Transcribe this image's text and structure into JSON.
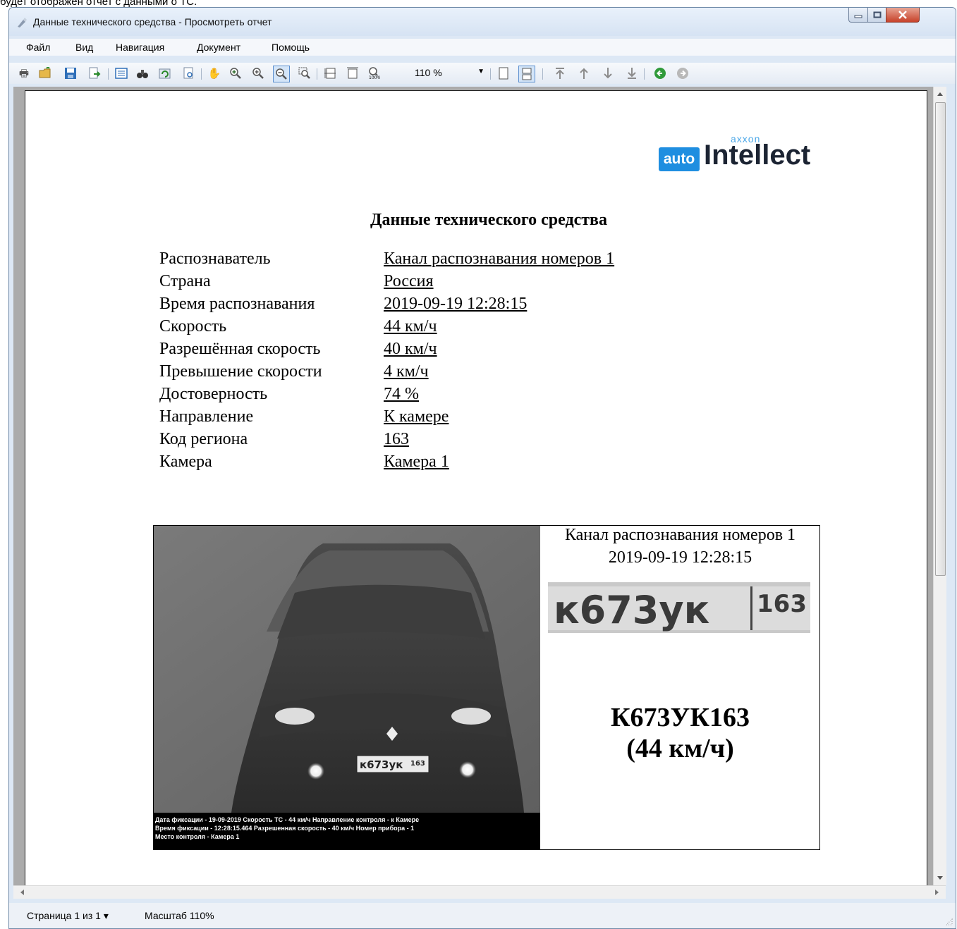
{
  "caption": "будет отображен отчет с данными о ТС.",
  "window": {
    "title": "Данные технического средства - Просмотреть отчет"
  },
  "menu": [
    "Файл",
    "Вид",
    "Навигация",
    "Документ",
    "Помощь"
  ],
  "toolbar": {
    "zoom_value": "110 %"
  },
  "report": {
    "logo": {
      "badge": "auto",
      "name": "Intellect",
      "small": "axxon"
    },
    "title": "Данные технического средства",
    "fields": [
      {
        "label": "Распознаватель",
        "value": "Канал распознавания номеров 1"
      },
      {
        "label": "Страна",
        "value": "Россия"
      },
      {
        "label": "Время распознавания",
        "value": "2019-09-19 12:28:15"
      },
      {
        "label": "Скорость",
        "value": "44 км/ч"
      },
      {
        "label": "Разрешённая скорость",
        "value": "40 км/ч"
      },
      {
        "label": "Превышение скорости",
        "value": "4 км/ч"
      },
      {
        "label": "Достоверность",
        "value": "74 %"
      },
      {
        "label": "Направление",
        "value": "К камере"
      },
      {
        "label": "Код региона",
        "value": "163"
      },
      {
        "label": "Камера",
        "value": "Камера 1"
      }
    ],
    "event": {
      "channel": "Канал распознавания номеров 1",
      "time": "2019-09-19 12:28:15",
      "plate_crop_text": "к673ук",
      "plate_crop_region": "163",
      "photo_plate": "к673ук",
      "photo_plate_region": "163",
      "plate": "К673УК163",
      "speed": "(44 км/ч)",
      "photo_footer": [
        "Дата фиксации - 19-09-2019 Скорость ТС - 44 км/ч        Направление контроля - к Камере",
        "Время фиксации - 12:28:15.464     Разрешенная скорость - 40 км/ч     Номер прибора - 1",
        "Место контроля - Камера 1"
      ]
    }
  },
  "status": {
    "page": "Страница 1 из 1 ▾",
    "zoom": "Масштаб 110%"
  }
}
